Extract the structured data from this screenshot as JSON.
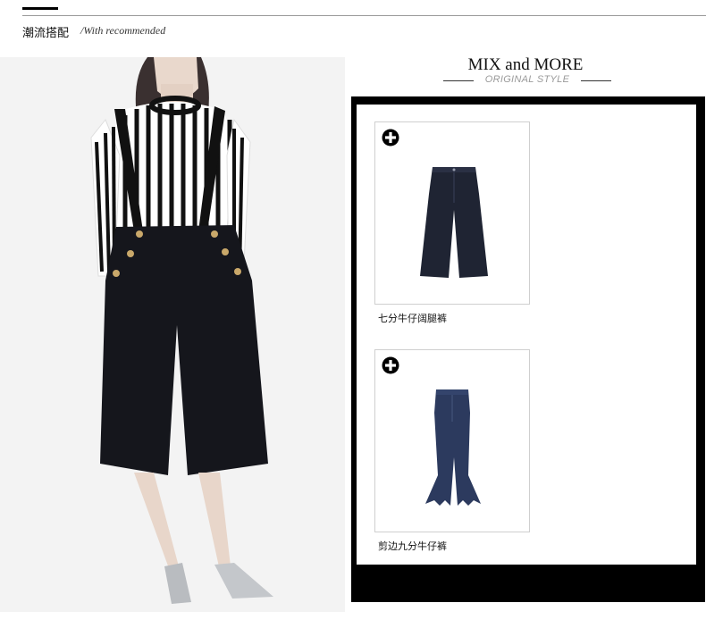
{
  "header": {
    "title": "潮流搭配",
    "subtitle": "/With recommended"
  },
  "mix": {
    "title": "MIX and MORE",
    "subtitle": "ORIGINAL STYLE"
  },
  "products": [
    {
      "label": "七分牛仔阔腿裤",
      "icon": "plus-circle-icon",
      "color": "#1f2433"
    },
    {
      "label": "剪边九分牛仔裤",
      "icon": "plus-circle-icon",
      "color": "#2c3a5e"
    }
  ],
  "colors": {
    "accent": "#000000",
    "denim_dark": "#1f2433",
    "denim_blue": "#2c3a5e"
  }
}
